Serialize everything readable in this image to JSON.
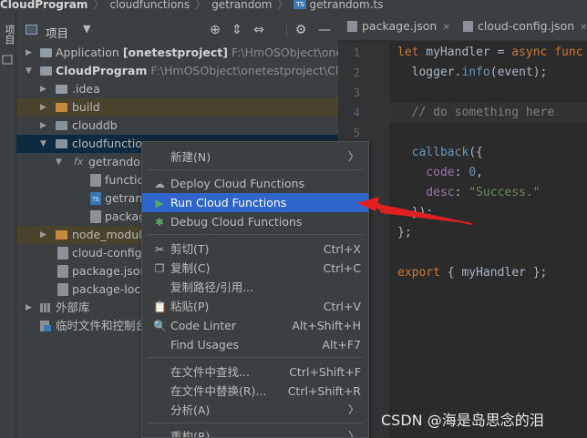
{
  "breadcrumb": {
    "project": "CloudProgram",
    "folder1": "cloudfunctions",
    "folder2": "getrandom",
    "file": "getrandom.ts"
  },
  "left_strip": {
    "label": "项目"
  },
  "panel": {
    "title": "项目",
    "rows": [
      {
        "name": "Application",
        "bold_suffix": "[onetestproject]",
        "path": "F:\\HmOSObject\\onetest"
      },
      {
        "name": "CloudProgram",
        "path": "F:\\HmOSObject\\onetestproject\\Cloud"
      },
      {
        "name": ".idea"
      },
      {
        "name": "build"
      },
      {
        "name": "clouddb"
      },
      {
        "name": "cloudfunction"
      },
      {
        "name": "getrandon"
      },
      {
        "name": "functio"
      },
      {
        "name": "getran"
      },
      {
        "name": "packag"
      },
      {
        "name": "node_module"
      },
      {
        "name": "cloud-config."
      },
      {
        "name": "package.json"
      },
      {
        "name": "package-lock"
      },
      {
        "name": "外部库"
      },
      {
        "name": "临时文件和控制台"
      }
    ],
    "fx_label": "fx"
  },
  "editor": {
    "tabs": [
      {
        "label": "package.json"
      },
      {
        "label": "cloud-config.json"
      }
    ],
    "line_numbers": [
      "1",
      "2",
      "3",
      "4",
      "5",
      "6",
      "7",
      "8",
      "9",
      "10",
      "11"
    ],
    "code": {
      "l1_kw": "let",
      "l1_name": " myHandler = ",
      "l1_async": "async",
      "l1_func": " func",
      "l2_a": "  logger.",
      "l2_b": "info",
      "l2_c": "(event);",
      "l4": "  // do something here",
      "l6_a": "  callback",
      "l6_b": "({",
      "l7_a": "    code",
      "l7_b": ": ",
      "l7_c": "0",
      "l7_d": ",",
      "l8_a": "    desc",
      "l8_b": ": ",
      "l8_c": "\"Success.\"",
      "l9": "  });",
      "l10": "};",
      "l12_kw": "export",
      "l12_rest": " { myHandler };"
    }
  },
  "context_menu": {
    "items": [
      {
        "label": "新建(N)",
        "submenu": true
      },
      {
        "label": "Deploy Cloud Functions",
        "icon": "cloud-upload-icon"
      },
      {
        "label": "Run Cloud Functions",
        "icon": "run-icon",
        "active": true
      },
      {
        "label": "Debug Cloud Functions",
        "icon": "debug-icon"
      },
      {
        "label": "剪切(T)",
        "shortcut": "Ctrl+X",
        "icon": "cut-icon"
      },
      {
        "label": "复制(C)",
        "shortcut": "Ctrl+C",
        "icon": "copy-icon"
      },
      {
        "label": "复制路径/引用..."
      },
      {
        "label": "粘贴(P)",
        "shortcut": "Ctrl+V",
        "icon": "paste-icon"
      },
      {
        "label": "Code Linter",
        "shortcut": "Alt+Shift+H",
        "icon": "linter-icon"
      },
      {
        "label": "Find Usages",
        "shortcut": "Alt+F7"
      },
      {
        "label": "在文件中查找...",
        "shortcut": "Ctrl+Shift+F"
      },
      {
        "label": "在文件中替换(R)...",
        "shortcut": "Ctrl+Shift+R"
      },
      {
        "label": "分析(A)",
        "submenu": true
      },
      {
        "label": "重构(R)",
        "submenu": true
      }
    ]
  },
  "watermark": "CSDN @海是岛思念的泪",
  "colors": {
    "accent_selection": "#2f65ca",
    "arrow_red": "#e02020",
    "keyword": "#cc7832",
    "string": "#6a8759",
    "number": "#6897bb"
  }
}
